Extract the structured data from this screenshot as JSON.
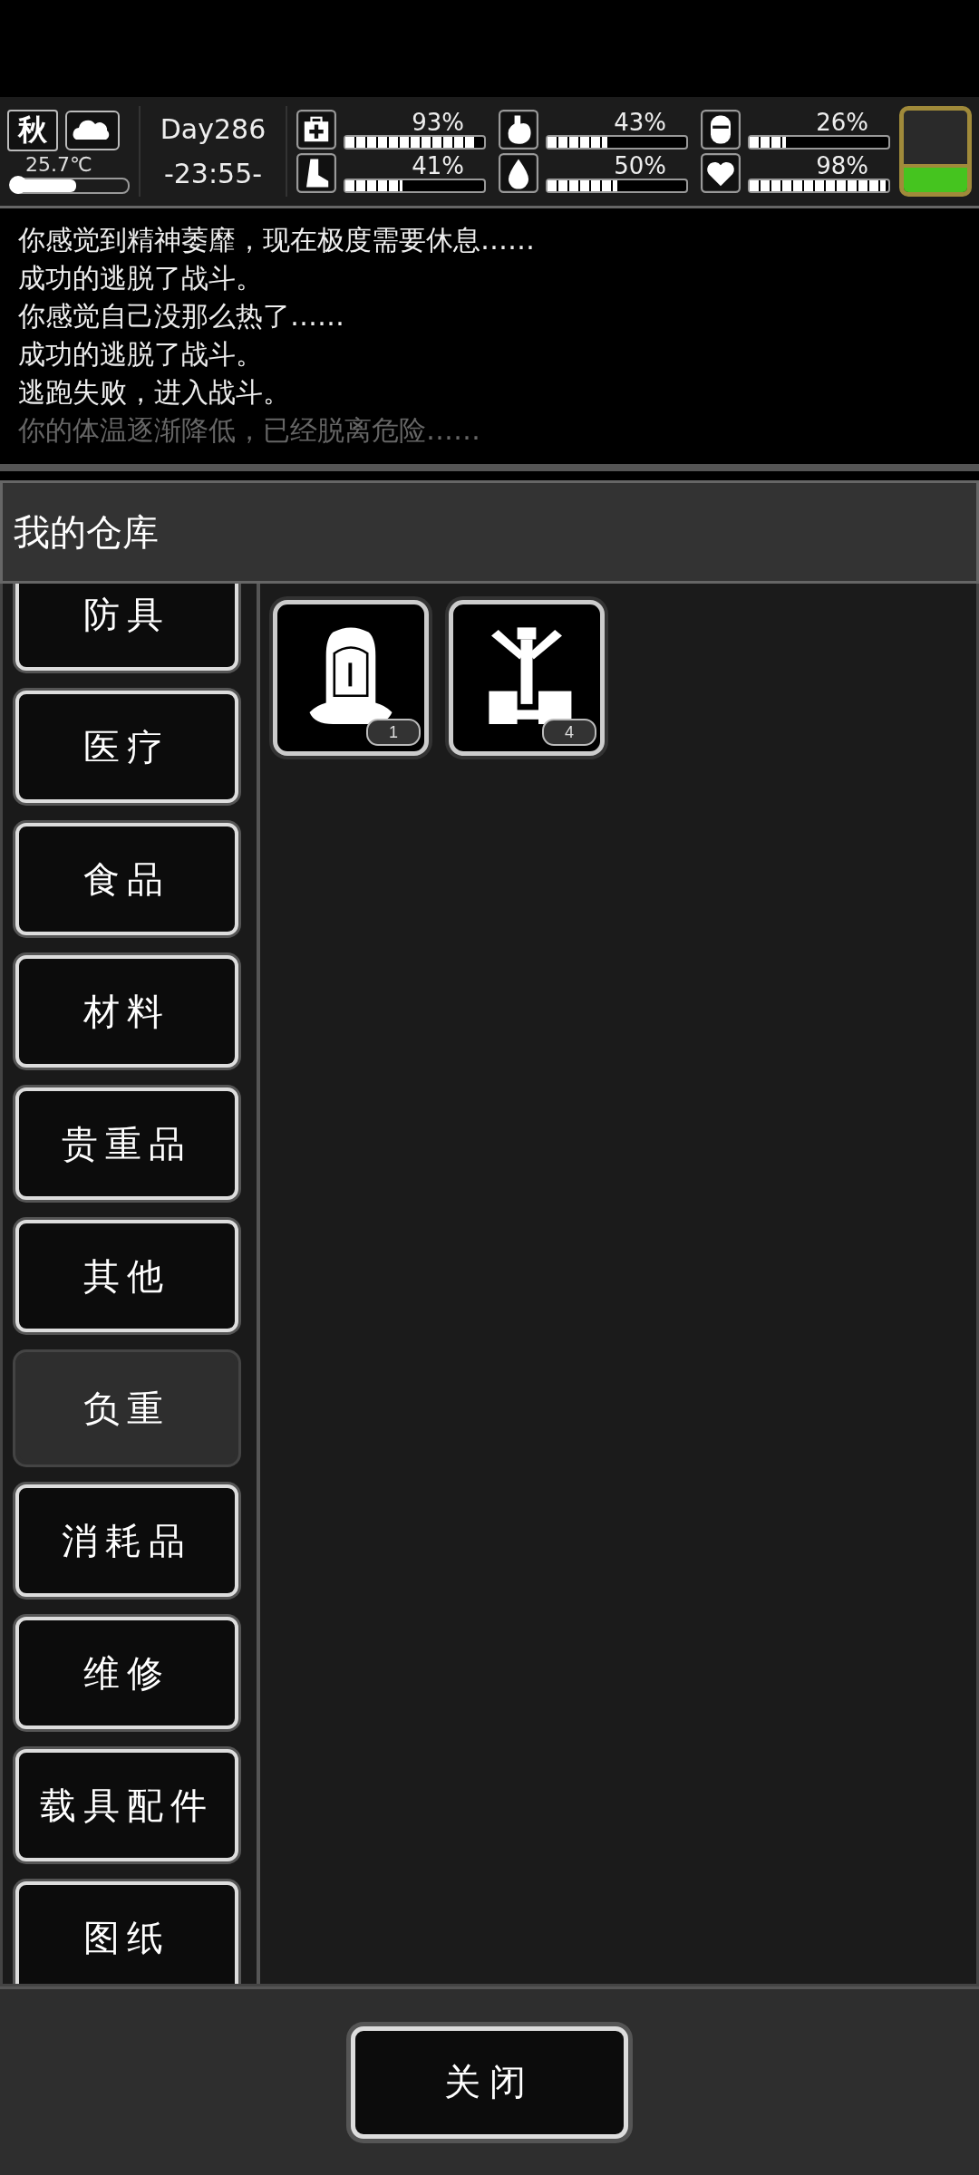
{
  "hud": {
    "season": "秋",
    "temperature": "25.7℃",
    "temperature_level": {
      "level": 0.55
    },
    "day": "Day286",
    "time": "-23:55-",
    "battery": {
      "level": 0.3
    },
    "stats": [
      {
        "kind": "health",
        "reading": "93%",
        "level": 0.93
      },
      {
        "kind": "hunger",
        "reading": "43%",
        "level": 0.43
      },
      {
        "kind": "bladder",
        "reading": "26%",
        "level": 0.26
      },
      {
        "kind": "stamina",
        "reading": "41%",
        "level": 0.41
      },
      {
        "kind": "thirst",
        "reading": "50%",
        "level": 0.5
      },
      {
        "kind": "mood",
        "reading": "98%",
        "level": 0.98
      }
    ]
  },
  "log": [
    {
      "text": "你感觉到精神萎靡，现在极度需要休息……",
      "faded": false
    },
    {
      "text": "成功的逃脱了战斗。",
      "faded": false
    },
    {
      "text": "你感觉自己没那么热了……",
      "faded": false
    },
    {
      "text": "成功的逃脱了战斗。",
      "faded": false
    },
    {
      "text": "逃跑失败，进入战斗。",
      "faded": false
    },
    {
      "text": "你的体温逐渐降低，已经脱离危险……",
      "faded": true
    }
  ],
  "panel": {
    "title": "我的仓库",
    "categories": [
      {
        "label": "防具",
        "selected": false
      },
      {
        "label": "医疗",
        "selected": false
      },
      {
        "label": "食品",
        "selected": false
      },
      {
        "label": "材料",
        "selected": false
      },
      {
        "label": "贵重品",
        "selected": false
      },
      {
        "label": "其他",
        "selected": false
      },
      {
        "label": "负重",
        "selected": true
      },
      {
        "label": "消耗品",
        "selected": false
      },
      {
        "label": "维修",
        "selected": false
      },
      {
        "label": "载具配件",
        "selected": false
      },
      {
        "label": "图纸",
        "selected": false
      }
    ],
    "items": [
      {
        "kind": "backpack",
        "count": "1"
      },
      {
        "kind": "rack",
        "count": "4"
      }
    ],
    "close_button": "关闭"
  }
}
